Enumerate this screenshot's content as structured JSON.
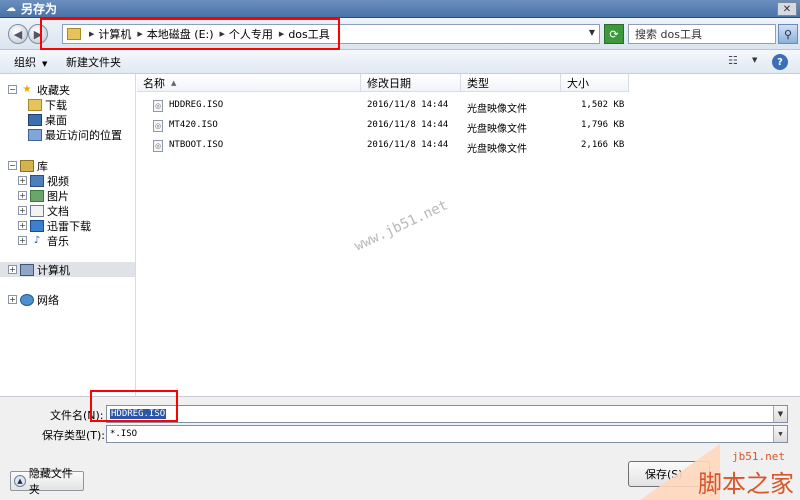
{
  "window": {
    "title": "另存为",
    "close_glyph": "✕"
  },
  "addressbar": {
    "crumbs": [
      "计算机",
      "本地磁盘 (E:)",
      "个人专用",
      "dos工具"
    ],
    "search_placeholder": "搜索 dos工具"
  },
  "toolbar": {
    "organize": "组织",
    "new_folder": "新建文件夹"
  },
  "nav": {
    "favorites": "收藏夹",
    "favorites_items": [
      "下载",
      "桌面",
      "最近访问的位置"
    ],
    "libraries": "库",
    "library_items": [
      "视频",
      "图片",
      "文档",
      "迅雷下载",
      "音乐"
    ],
    "computer": "计算机",
    "network": "网络"
  },
  "columns": {
    "name": "名称",
    "date": "修改日期",
    "type": "类型",
    "size": "大小"
  },
  "files": [
    {
      "name": "HDDREG.ISO",
      "date": "2016/11/8 14:44",
      "type": "光盘映像文件",
      "size": "1,502 KB"
    },
    {
      "name": "MT420.ISO",
      "date": "2016/11/8 14:44",
      "type": "光盘映像文件",
      "size": "1,796 KB"
    },
    {
      "name": "NTBOOT.ISO",
      "date": "2016/11/8 14:44",
      "type": "光盘映像文件",
      "size": "2,166 KB"
    }
  ],
  "form": {
    "filename_label": "文件名(N):",
    "filename_value": "HDDREG.ISO",
    "filetype_label": "保存类型(T):",
    "filetype_value": "*.ISO"
  },
  "buttons": {
    "hide_folders": "隐藏文件夹",
    "save": "保存(S)"
  },
  "watermark": "www.jb51.net",
  "logo": {
    "site": "jb51.net",
    "brand": "脚本之家"
  }
}
